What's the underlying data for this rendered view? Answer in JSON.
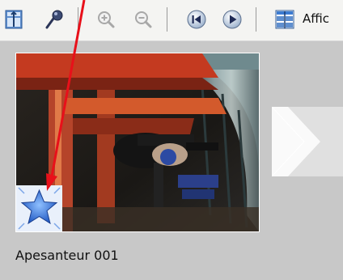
{
  "toolbar": {
    "buttons": [
      {
        "icon": "storyboard-view-icon"
      },
      {
        "icon": "effects-wand-icon"
      },
      {
        "icon": "zoom-in-icon"
      },
      {
        "icon": "zoom-out-icon"
      },
      {
        "icon": "rewind-icon"
      },
      {
        "icon": "play-icon"
      },
      {
        "icon": "display-timeline-icon"
      }
    ],
    "display_label": "Affic"
  },
  "clip": {
    "name": "Apesanteur 001",
    "transition_icon": "star-transition-icon"
  },
  "colors": {
    "annotation_arrow": "#e8101a",
    "workspace_bg": "#c8c8c8",
    "toolbar_bg": "#f4f4f2",
    "star_blue": "#2f6fd6"
  }
}
